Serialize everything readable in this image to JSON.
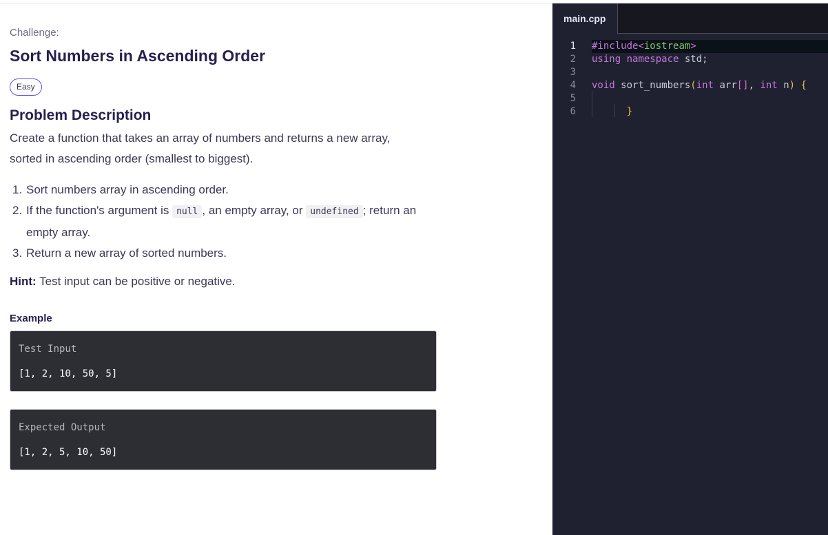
{
  "challenge": {
    "label": "Challenge:",
    "title": "Sort Numbers in Ascending Order",
    "difficulty": "Easy",
    "section_heading": "Problem Description",
    "description": "Create a function that takes an array of numbers and returns a new array, sorted in ascending order (smallest to biggest).",
    "steps": [
      {
        "num": "1.",
        "text": "Sort numbers array in ascending order."
      },
      {
        "num": "2.",
        "pre": "If the function's argument is ",
        "code1": "null",
        "mid": ", an empty array, or ",
        "code2": "undefined",
        "post": "; return an empty array."
      },
      {
        "num": "3.",
        "text": "Return a new array of sorted numbers."
      }
    ],
    "hint_label": "Hint:",
    "hint_text": " Test input can be positive or negative.",
    "example_label": "Example",
    "test_input_label": "Test Input",
    "test_input_value": "[1, 2, 10, 50, 5]",
    "expected_output_label": "Expected Output",
    "expected_output_value": "[1, 2, 5, 10, 50]"
  },
  "editor": {
    "tab": "main.cpp",
    "lines": [
      {
        "n": "1",
        "tokens": [
          [
            "#include",
            "kw"
          ],
          [
            "<",
            "kw"
          ],
          [
            "iostream",
            "str"
          ],
          [
            ">",
            "kw"
          ]
        ]
      },
      {
        "n": "2",
        "tokens": [
          [
            "using",
            "kw"
          ],
          [
            " ",
            "pl"
          ],
          [
            "namespace",
            "kw"
          ],
          [
            " std;",
            "pl"
          ]
        ]
      },
      {
        "n": "3",
        "tokens": []
      },
      {
        "n": "4",
        "tokens": [
          [
            "void",
            "kw"
          ],
          [
            " sort_numbers",
            "pl"
          ],
          [
            "(",
            "br"
          ],
          [
            "int",
            "kw"
          ],
          [
            " arr",
            "pl"
          ],
          [
            "[]",
            "pk"
          ],
          [
            ", ",
            "pl"
          ],
          [
            "int",
            "kw"
          ],
          [
            " n",
            "pl"
          ],
          [
            ")",
            "br"
          ],
          [
            " ",
            "pl"
          ],
          [
            "{",
            "br"
          ]
        ]
      },
      {
        "n": "5",
        "tokens": []
      },
      {
        "n": "6",
        "tokens": [
          [
            "      ",
            "pl"
          ],
          [
            "}",
            "br"
          ]
        ]
      }
    ]
  }
}
